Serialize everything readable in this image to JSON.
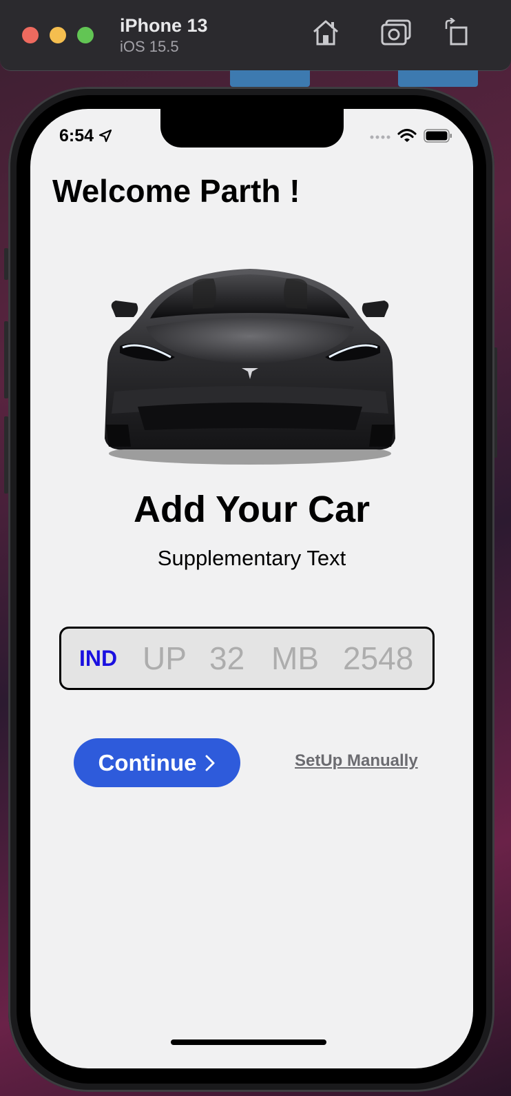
{
  "simulator": {
    "device_name": "iPhone 13",
    "os_version": "iOS 15.5",
    "toolbar_icons": [
      "home-icon",
      "screenshot-icon",
      "rotate-icon"
    ]
  },
  "status_bar": {
    "time": "6:54",
    "icons": [
      "location-icon",
      "signal-icon",
      "wifi-icon",
      "battery-icon"
    ]
  },
  "page": {
    "welcome": "Welcome Parth !",
    "title": "Add Your Car",
    "subtitle": "Supplementary Text"
  },
  "plate": {
    "country": "IND",
    "parts": [
      "UP",
      "32",
      "MB",
      "2548"
    ]
  },
  "actions": {
    "continue_label": "Continue",
    "manual_label": "SetUp Manually"
  },
  "colors": {
    "accent": "#2e5bdb",
    "country_code": "#1a10e0",
    "background": "#f1f1f2",
    "placeholder": "#adadad"
  }
}
